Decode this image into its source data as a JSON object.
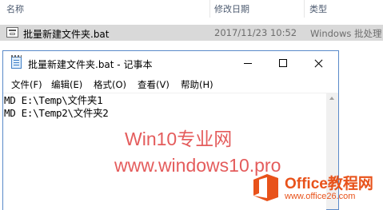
{
  "explorer": {
    "columns": {
      "name": "名称",
      "date_modified": "修改日期",
      "type": "类型"
    },
    "file": {
      "name": "批量新建文件夹.bat",
      "date_modified": "2017/11/23 10:52",
      "type": "Windows 批处理"
    }
  },
  "notepad": {
    "title": "批量新建文件夹.bat - 记事本",
    "menu": {
      "file": "文件(F)",
      "edit": "编辑(E)",
      "format": "格式(O)",
      "view": "查看(V)",
      "help": "帮助(H)"
    },
    "content_lines": [
      "MD E:\\Temp\\文件夹1",
      "MD E:\\Temp2\\文件夹2"
    ]
  },
  "watermark": {
    "line1": "Win10专业网",
    "line2": "www.windows10.pro"
  },
  "office_logo": {
    "brand": "Office教程网",
    "site": "www.office26.com"
  },
  "colors": {
    "watermark": "#e24b4b",
    "office_accent": "#e8521a",
    "window_border": "#5a8ac9",
    "selected_row": "#d9d9d9"
  }
}
